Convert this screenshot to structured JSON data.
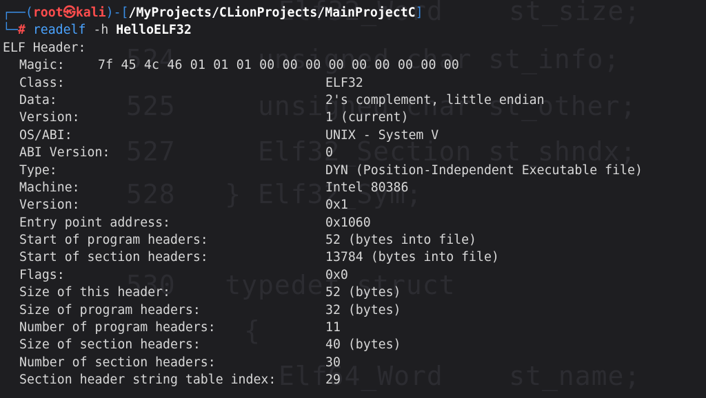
{
  "prompt": {
    "frame_top_left": "┌──(",
    "user": "root",
    "at_symbol": "㉿",
    "host": "kali",
    "frame_mid": ")-[",
    "path": "/MyProjects/CLionProjects/MainProjectC",
    "frame_end": "]",
    "frame_bottom": "└─",
    "hash": "#",
    "command": "readelf",
    "option": "-h",
    "argument": "HelloELF32"
  },
  "output": {
    "heading": "ELF Header:",
    "magic_label": "Magic:",
    "magic_value": "7f 45 4c 46 01 01 01 00 00 00 00 00 00 00 00 00",
    "fields": [
      {
        "key": "Class:",
        "value": "ELF32"
      },
      {
        "key": "Data:",
        "value": "2's complement, little endian"
      },
      {
        "key": "Version:",
        "value": "1 (current)"
      },
      {
        "key": "OS/ABI:",
        "value": "UNIX - System V"
      },
      {
        "key": "ABI Version:",
        "value": "0"
      },
      {
        "key": "Type:",
        "value": "DYN (Position-Independent Executable file)"
      },
      {
        "key": "Machine:",
        "value": "Intel 80386"
      },
      {
        "key": "Version:",
        "value": "0x1"
      },
      {
        "key": "Entry point address:",
        "value": "0x1060"
      },
      {
        "key": "Start of program headers:",
        "value": "52 (bytes into file)"
      },
      {
        "key": "Start of section headers:",
        "value": "13784 (bytes into file)"
      },
      {
        "key": "Flags:",
        "value": "0x0"
      },
      {
        "key": "Size of this header:",
        "value": "52 (bytes)"
      },
      {
        "key": "Size of program headers:",
        "value": "32 (bytes)"
      },
      {
        "key": "Number of program headers:",
        "value": "11"
      },
      {
        "key": "Size of section headers:",
        "value": "40 (bytes)"
      },
      {
        "key": "Number of section headers:",
        "value": "30"
      },
      {
        "key": "Section header string table index:",
        "value": "29"
      }
    ]
  },
  "background_watermark": [
    "Elf32_Word    st_size;",
    "524     unsigned char st_info;",
    "525     unsigned char st_other;",
    "527     Elf32_Section st_shndx;",
    "528   } Elf32_Sym;",
    "530   typedef struct",
    "{",
    "Elf64_Word    st_name;"
  ],
  "colors": {
    "background": "#1e1e21",
    "frame_blue": "#3a8ee6",
    "user_red": "#ff4d4d",
    "text": "#d8d8d8"
  }
}
